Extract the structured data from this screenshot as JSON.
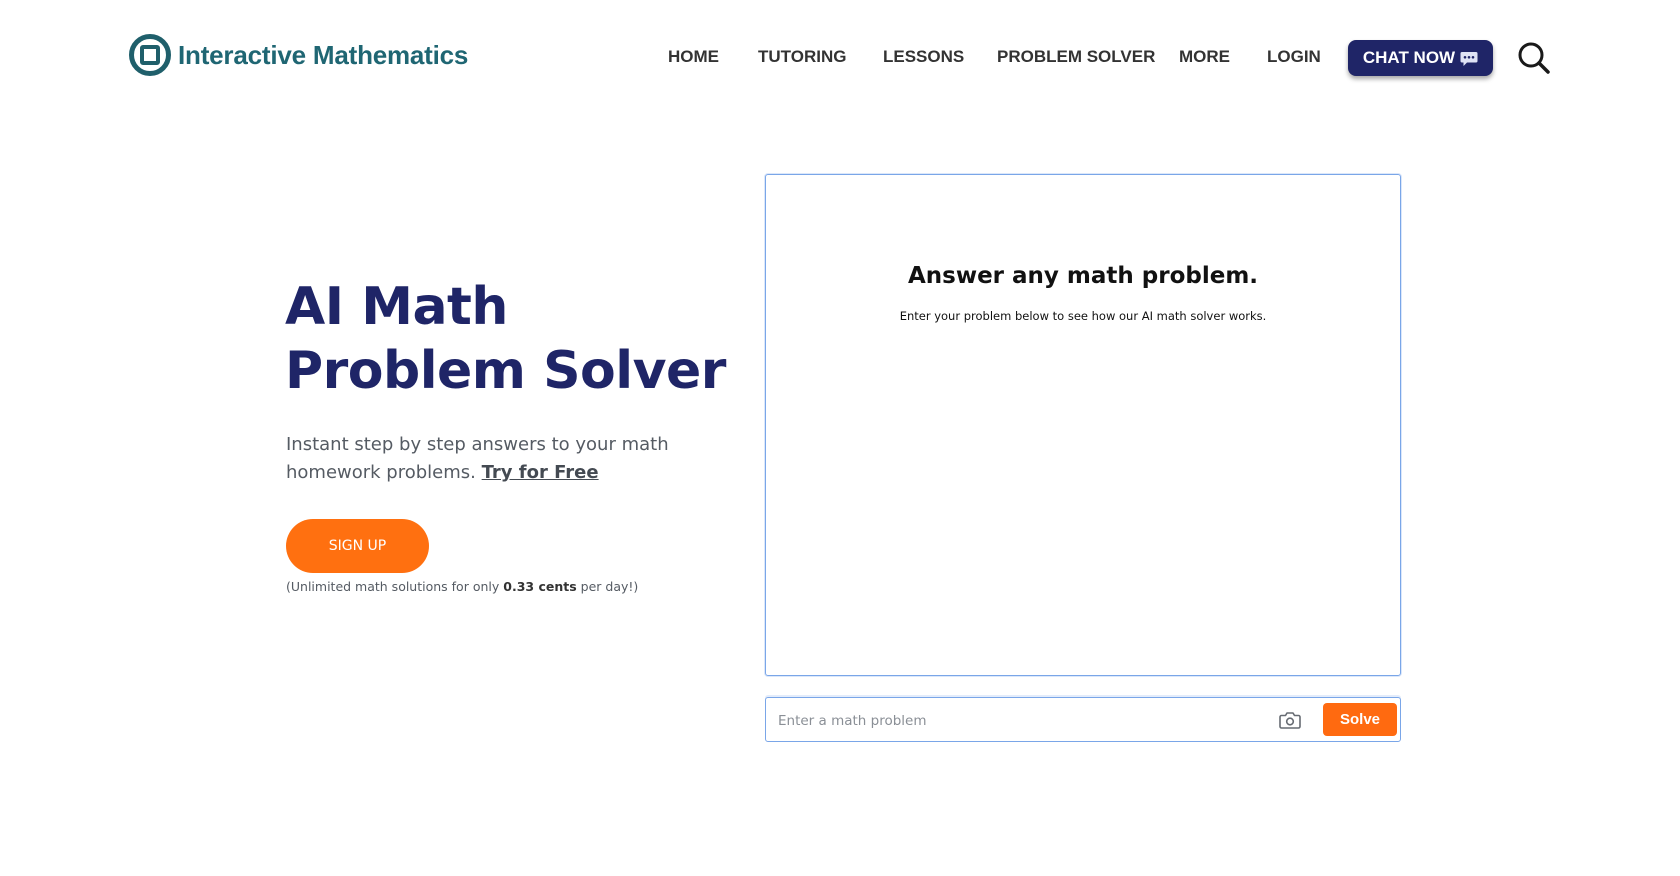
{
  "header": {
    "logo_text": "Interactive Mathematics",
    "nav": [
      {
        "label": "HOME"
      },
      {
        "label": "TUTORING"
      },
      {
        "label": "LESSONS"
      },
      {
        "label": "PROBLEM SOLVER"
      },
      {
        "label": "MORE"
      },
      {
        "label": "LOGIN"
      }
    ],
    "chat_button": "CHAT NOW",
    "icons": {
      "logo": "logo-icon",
      "chat": "speech-bubble-icon",
      "search": "search-icon"
    }
  },
  "hero": {
    "title": "AI Math Problem Solver",
    "subtitle": "Instant step by step answers to your math homework problems.",
    "try_link": "Try for Free",
    "signup_button": "SIGN UP",
    "price_note_prefix": "(Unlimited math solutions for only",
    "price_note_value": "0.33 cents",
    "price_note_suffix": "per day!)"
  },
  "solver": {
    "title": "Answer any math problem.",
    "description": "Enter your problem below to see how our AI math solver works.",
    "input_placeholder": "Enter a math problem",
    "input_value": "",
    "solve_button": "Solve",
    "camera_icon": "camera-icon"
  },
  "colors": {
    "brand_teal": "#1f6673",
    "navy": "#1f2567",
    "accent_orange": "#ff7010",
    "panel_border": "#7aa6e8"
  }
}
